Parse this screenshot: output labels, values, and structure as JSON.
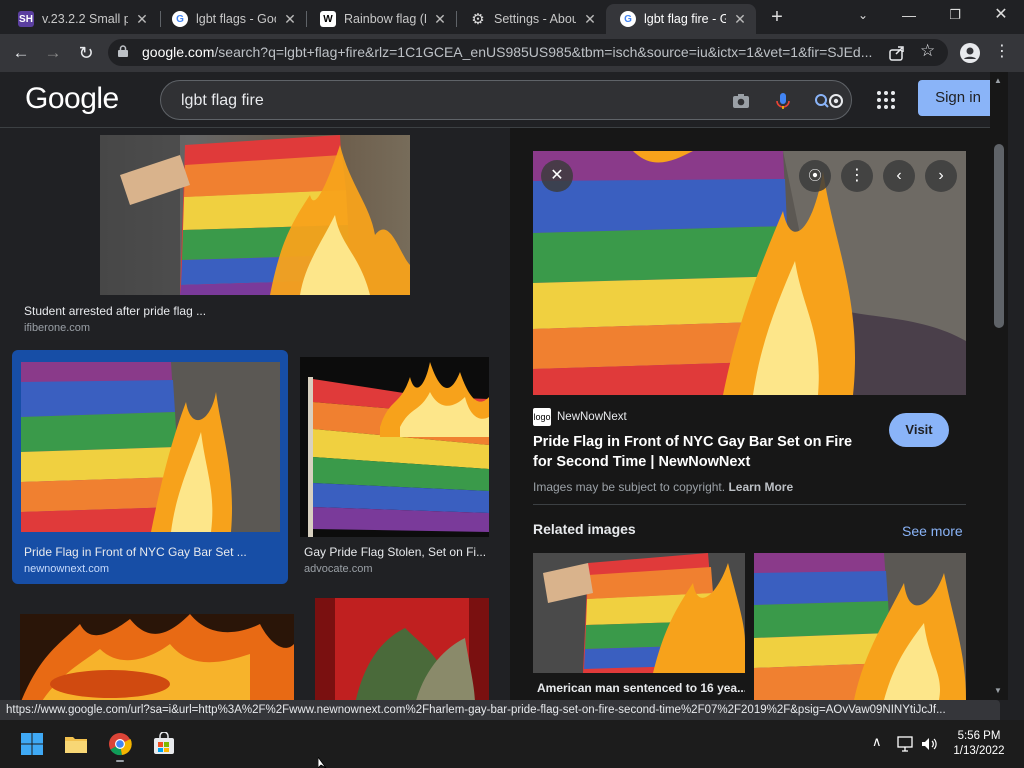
{
  "browser": {
    "tabs": [
      {
        "label": "v.23.2.2 Small pa",
        "favicon": "SH"
      },
      {
        "label": "lgbt flags - Goo",
        "favicon": "G"
      },
      {
        "label": "Rainbow flag (L",
        "favicon": "W"
      },
      {
        "label": "Settings - About",
        "favicon": "gear"
      },
      {
        "label": "lgbt flag fire - G",
        "favicon": "G",
        "active": true
      }
    ],
    "url_host": "google.com",
    "url_rest": "/search?q=lgbt+flag+fire&rlz=1C1GCEA_enUS985US985&tbm=isch&source=iu&ictx=1&vet=1&fir=SJEd..."
  },
  "google": {
    "logo": "Google",
    "query": "lgbt flag fire",
    "sign_in": "Sign in"
  },
  "results": [
    {
      "title": "Student arrested after pride flag ...",
      "source": "ifiberone.com"
    },
    {
      "title": "Pride Flag in Front of NYC Gay Bar Set ...",
      "source": "newnownext.com",
      "selected": true
    },
    {
      "title": "Gay Pride Flag Stolen, Set on Fi...",
      "source": "advocate.com"
    }
  ],
  "panel": {
    "publisher": "NewNowNext",
    "publisher_favicon": "logo",
    "title": "Pride Flag in Front of NYC Gay Bar Set on Fire for Second Time | NewNowNext",
    "visit": "Visit",
    "copyright": "Images may be subject to copyright.",
    "learn_more": "Learn More",
    "related_heading": "Related images",
    "see_more": "See more",
    "related_caption": "American man sentenced to 16 yea..."
  },
  "status_url": "https://www.google.com/url?sa=i&url=http%3A%2F%2Fwww.newnownext.com%2Fharlem-gay-bar-pride-flag-set-on-fire-second-time%2F07%2F2019%2F&psig=AOvVaw09NINYtiJcJf...",
  "taskbar": {
    "time": "5:56 PM",
    "date": "1/13/2022"
  },
  "colors": {
    "accent": "#8ab4f8",
    "selected": "#174ea6",
    "background": "#202124"
  }
}
